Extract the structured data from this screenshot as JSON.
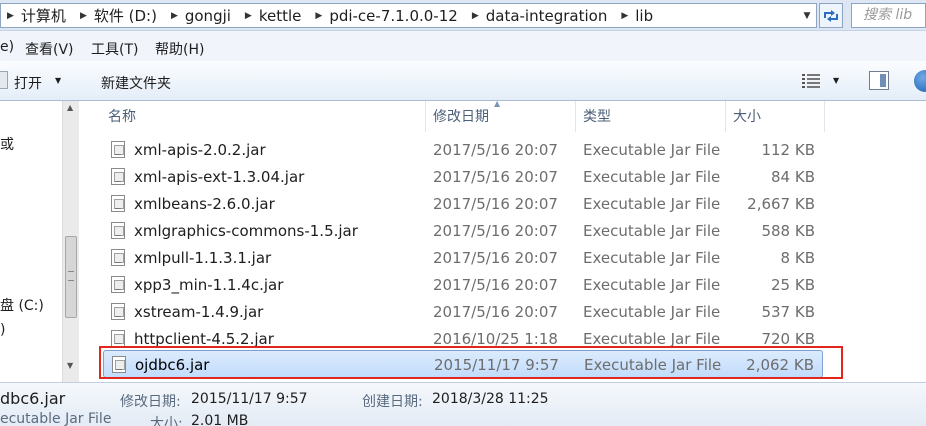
{
  "address": {
    "segments": [
      "计算机",
      "软件 (D:)",
      "gongji",
      "kettle",
      "pdi-ce-7.1.0.0-12",
      "data-integration",
      "lib"
    ],
    "search_placeholder": "搜索 lib"
  },
  "menu": {
    "items": [
      "e)",
      "查看(V)",
      "工具(T)",
      "帮助(H)"
    ]
  },
  "commandbar": {
    "open_label": "打开",
    "new_folder_label": "新建文件夹"
  },
  "nav": {
    "item_top": "或",
    "drive_c": "盘 (C:)",
    "drive_d": ")"
  },
  "columns": {
    "name": "名称",
    "date": "修改日期",
    "type": "类型",
    "size": "大小"
  },
  "files": [
    {
      "name": "xml-apis-2.0.2.jar",
      "date": "2017/5/16 20:07",
      "type": "Executable Jar File",
      "size": "112 KB"
    },
    {
      "name": "xml-apis-ext-1.3.04.jar",
      "date": "2017/5/16 20:07",
      "type": "Executable Jar File",
      "size": "84 KB"
    },
    {
      "name": "xmlbeans-2.6.0.jar",
      "date": "2017/5/16 20:07",
      "type": "Executable Jar File",
      "size": "2,667 KB"
    },
    {
      "name": "xmlgraphics-commons-1.5.jar",
      "date": "2017/5/16 20:07",
      "type": "Executable Jar File",
      "size": "588 KB"
    },
    {
      "name": "xmlpull-1.1.3.1.jar",
      "date": "2017/5/16 20:07",
      "type": "Executable Jar File",
      "size": "8 KB"
    },
    {
      "name": "xpp3_min-1.1.4c.jar",
      "date": "2017/5/16 20:07",
      "type": "Executable Jar File",
      "size": "25 KB"
    },
    {
      "name": "xstream-1.4.9.jar",
      "date": "2017/5/16 20:07",
      "type": "Executable Jar File",
      "size": "537 KB"
    },
    {
      "name": "httpclient-4.5.2.jar",
      "date": "2016/10/25 1:18",
      "type": "Executable Jar File",
      "size": "720 KB"
    },
    {
      "name": "ojdbc6.jar",
      "date": "2015/11/17 9:57",
      "type": "Executable Jar File",
      "size": "2,062 KB",
      "selected": true
    }
  ],
  "details": {
    "filename": "dbc6.jar",
    "filetype": "ecutable Jar File",
    "modified_label": "修改日期:",
    "modified_value": "2015/11/17 9:57",
    "created_label": "创建日期:",
    "created_value": "2018/3/28 11:25",
    "size_label": "大小:",
    "size_value": "2.01 MB"
  },
  "colors": {
    "highlight": "#e1261e",
    "selection": "#c1dcfc"
  }
}
